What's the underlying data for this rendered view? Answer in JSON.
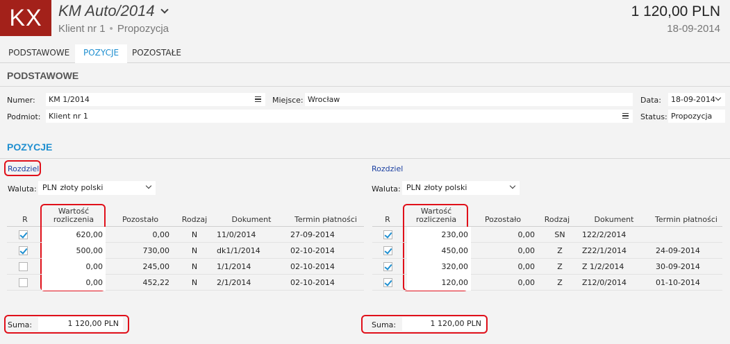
{
  "header": {
    "logo": "KX",
    "title": "KM Auto/2014",
    "client": "Klient nr 1",
    "separator": "•",
    "status": "Propozycja",
    "amount": "1 120,00 PLN",
    "date": "18-09-2014"
  },
  "tabs": [
    "PODSTAWOWE",
    "POZYCJE",
    "POZOSTAŁE"
  ],
  "basic": {
    "title": "PODSTAWOWE",
    "numer_label": "Numer:",
    "numer_value": "KM 1/2014",
    "miejsce_label": "Miejsce:",
    "miejsce_value": "Wrocław",
    "data_label": "Data:",
    "data_value": "18-09-2014",
    "podmiot_label": "Podmiot:",
    "podmiot_value": "Klient nr 1",
    "status_label": "Status:",
    "status_value": "Propozycja"
  },
  "positions": {
    "title": "POZYCJE",
    "left": {
      "split_link": "Rozdziel",
      "currency_label": "Waluta:",
      "currency_code": "PLN",
      "currency_name": "złoty polski",
      "columns": [
        "R",
        "Wartość",
        "rozliczenia",
        "Pozostało",
        "Rodzaj",
        "Dokument",
        "Termin płatności"
      ],
      "rows": [
        {
          "checked": true,
          "value": "620,00",
          "remaining": "0,00",
          "kind": "N",
          "doc": "11/0/2014",
          "due": "27-09-2014"
        },
        {
          "checked": true,
          "value": "500,00",
          "remaining": "730,00",
          "kind": "N",
          "doc": "dk1/1/2014",
          "due": "02-10-2014"
        },
        {
          "checked": false,
          "value": "0,00",
          "remaining": "245,00",
          "kind": "N",
          "doc": "1/1/2014",
          "due": "02-10-2014"
        },
        {
          "checked": false,
          "value": "0,00",
          "remaining": "452,22",
          "kind": "N",
          "doc": "2/1/2014",
          "due": "02-10-2014"
        }
      ],
      "sum_label": "Suma:",
      "sum_value": "1 120,00 PLN"
    },
    "right": {
      "split_link": "Rozdziel",
      "currency_label": "Waluta:",
      "currency_code": "PLN",
      "currency_name": "złoty polski",
      "columns": [
        "R",
        "Wartość",
        "rozliczenia",
        "Pozostało",
        "Rodzaj",
        "Dokument",
        "Termin płatności"
      ],
      "rows": [
        {
          "checked": true,
          "value": "230,00",
          "remaining": "0,00",
          "kind": "SN",
          "doc": "122/2/2014",
          "due": ""
        },
        {
          "checked": true,
          "value": "450,00",
          "remaining": "0,00",
          "kind": "Z",
          "doc": "Z22/1/2014",
          "due": "24-09-2014"
        },
        {
          "checked": true,
          "value": "320,00",
          "remaining": "0,00",
          "kind": "Z",
          "doc": "Z 1/2/2014",
          "due": "30-09-2014"
        },
        {
          "checked": true,
          "value": "120,00",
          "remaining": "0,00",
          "kind": "Z",
          "doc": "Z12/0/2014",
          "due": "01-10-2014"
        }
      ],
      "sum_label": "Suma:",
      "sum_value": "1 120,00 PLN"
    }
  },
  "colors": {
    "brand": "#a3211a",
    "accent": "#1f8fd0",
    "highlight": "#e0101a"
  }
}
